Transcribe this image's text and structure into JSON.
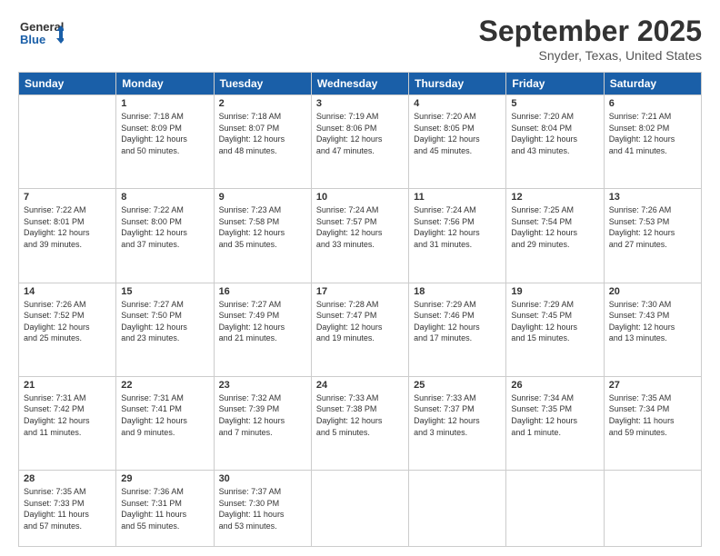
{
  "logo": {
    "line1": "General",
    "line2": "Blue"
  },
  "title": "September 2025",
  "subtitle": "Snyder, Texas, United States",
  "days_of_week": [
    "Sunday",
    "Monday",
    "Tuesday",
    "Wednesday",
    "Thursday",
    "Friday",
    "Saturday"
  ],
  "weeks": [
    [
      {
        "day": "",
        "info": ""
      },
      {
        "day": "1",
        "info": "Sunrise: 7:18 AM\nSunset: 8:09 PM\nDaylight: 12 hours\nand 50 minutes."
      },
      {
        "day": "2",
        "info": "Sunrise: 7:18 AM\nSunset: 8:07 PM\nDaylight: 12 hours\nand 48 minutes."
      },
      {
        "day": "3",
        "info": "Sunrise: 7:19 AM\nSunset: 8:06 PM\nDaylight: 12 hours\nand 47 minutes."
      },
      {
        "day": "4",
        "info": "Sunrise: 7:20 AM\nSunset: 8:05 PM\nDaylight: 12 hours\nand 45 minutes."
      },
      {
        "day": "5",
        "info": "Sunrise: 7:20 AM\nSunset: 8:04 PM\nDaylight: 12 hours\nand 43 minutes."
      },
      {
        "day": "6",
        "info": "Sunrise: 7:21 AM\nSunset: 8:02 PM\nDaylight: 12 hours\nand 41 minutes."
      }
    ],
    [
      {
        "day": "7",
        "info": "Sunrise: 7:22 AM\nSunset: 8:01 PM\nDaylight: 12 hours\nand 39 minutes."
      },
      {
        "day": "8",
        "info": "Sunrise: 7:22 AM\nSunset: 8:00 PM\nDaylight: 12 hours\nand 37 minutes."
      },
      {
        "day": "9",
        "info": "Sunrise: 7:23 AM\nSunset: 7:58 PM\nDaylight: 12 hours\nand 35 minutes."
      },
      {
        "day": "10",
        "info": "Sunrise: 7:24 AM\nSunset: 7:57 PM\nDaylight: 12 hours\nand 33 minutes."
      },
      {
        "day": "11",
        "info": "Sunrise: 7:24 AM\nSunset: 7:56 PM\nDaylight: 12 hours\nand 31 minutes."
      },
      {
        "day": "12",
        "info": "Sunrise: 7:25 AM\nSunset: 7:54 PM\nDaylight: 12 hours\nand 29 minutes."
      },
      {
        "day": "13",
        "info": "Sunrise: 7:26 AM\nSunset: 7:53 PM\nDaylight: 12 hours\nand 27 minutes."
      }
    ],
    [
      {
        "day": "14",
        "info": "Sunrise: 7:26 AM\nSunset: 7:52 PM\nDaylight: 12 hours\nand 25 minutes."
      },
      {
        "day": "15",
        "info": "Sunrise: 7:27 AM\nSunset: 7:50 PM\nDaylight: 12 hours\nand 23 minutes."
      },
      {
        "day": "16",
        "info": "Sunrise: 7:27 AM\nSunset: 7:49 PM\nDaylight: 12 hours\nand 21 minutes."
      },
      {
        "day": "17",
        "info": "Sunrise: 7:28 AM\nSunset: 7:47 PM\nDaylight: 12 hours\nand 19 minutes."
      },
      {
        "day": "18",
        "info": "Sunrise: 7:29 AM\nSunset: 7:46 PM\nDaylight: 12 hours\nand 17 minutes."
      },
      {
        "day": "19",
        "info": "Sunrise: 7:29 AM\nSunset: 7:45 PM\nDaylight: 12 hours\nand 15 minutes."
      },
      {
        "day": "20",
        "info": "Sunrise: 7:30 AM\nSunset: 7:43 PM\nDaylight: 12 hours\nand 13 minutes."
      }
    ],
    [
      {
        "day": "21",
        "info": "Sunrise: 7:31 AM\nSunset: 7:42 PM\nDaylight: 12 hours\nand 11 minutes."
      },
      {
        "day": "22",
        "info": "Sunrise: 7:31 AM\nSunset: 7:41 PM\nDaylight: 12 hours\nand 9 minutes."
      },
      {
        "day": "23",
        "info": "Sunrise: 7:32 AM\nSunset: 7:39 PM\nDaylight: 12 hours\nand 7 minutes."
      },
      {
        "day": "24",
        "info": "Sunrise: 7:33 AM\nSunset: 7:38 PM\nDaylight: 12 hours\nand 5 minutes."
      },
      {
        "day": "25",
        "info": "Sunrise: 7:33 AM\nSunset: 7:37 PM\nDaylight: 12 hours\nand 3 minutes."
      },
      {
        "day": "26",
        "info": "Sunrise: 7:34 AM\nSunset: 7:35 PM\nDaylight: 12 hours\nand 1 minute."
      },
      {
        "day": "27",
        "info": "Sunrise: 7:35 AM\nSunset: 7:34 PM\nDaylight: 11 hours\nand 59 minutes."
      }
    ],
    [
      {
        "day": "28",
        "info": "Sunrise: 7:35 AM\nSunset: 7:33 PM\nDaylight: 11 hours\nand 57 minutes."
      },
      {
        "day": "29",
        "info": "Sunrise: 7:36 AM\nSunset: 7:31 PM\nDaylight: 11 hours\nand 55 minutes."
      },
      {
        "day": "30",
        "info": "Sunrise: 7:37 AM\nSunset: 7:30 PM\nDaylight: 11 hours\nand 53 minutes."
      },
      {
        "day": "",
        "info": ""
      },
      {
        "day": "",
        "info": ""
      },
      {
        "day": "",
        "info": ""
      },
      {
        "day": "",
        "info": ""
      }
    ]
  ]
}
